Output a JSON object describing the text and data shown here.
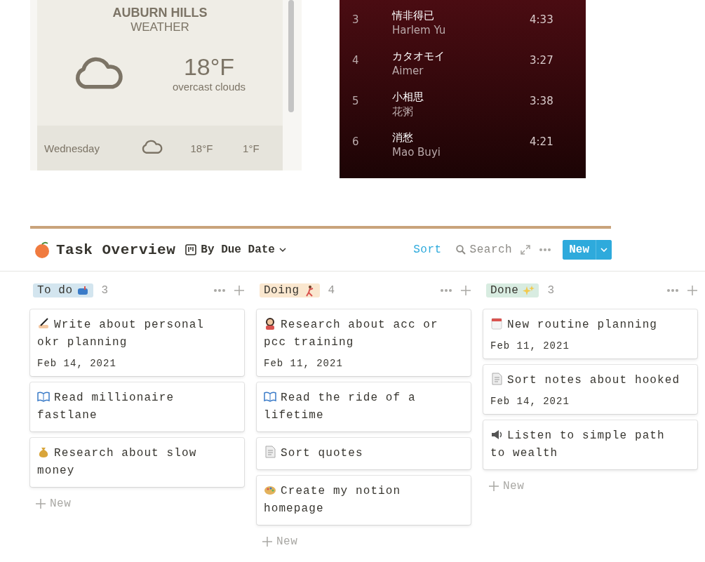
{
  "weather": {
    "city": "AUBURN HILLS",
    "subtitle": "WEATHER",
    "temperature": "18°F",
    "condition": "overcast clouds",
    "days": [
      {
        "day": "Wednesday",
        "high": "18°F",
        "low": "1°F"
      }
    ]
  },
  "playlist": {
    "tracks": [
      {
        "number": "3",
        "title": "情非得已",
        "artist": "Harlem Yu",
        "duration": "4:33"
      },
      {
        "number": "4",
        "title": "カタオモイ",
        "artist": "Aimer",
        "duration": "3:27"
      },
      {
        "number": "5",
        "title": "小相思",
        "artist": "花粥",
        "duration": "3:38"
      },
      {
        "number": "6",
        "title": "消愁",
        "artist": "Mao Buyi",
        "duration": "4:21"
      }
    ]
  },
  "board": {
    "title": "Task Overview",
    "view": "By Due Date",
    "actions": {
      "sort": "Sort",
      "search": "Search",
      "new": "New"
    },
    "columns": [
      {
        "label": "To do",
        "count": "3",
        "color": "#d3e5ef",
        "add": "New",
        "cards": [
          {
            "title": "Write about personal okr planning",
            "date": "Feb 14, 2021"
          },
          {
            "title": "Read millionaire fastlane"
          },
          {
            "title": "Research about slow money"
          }
        ]
      },
      {
        "label": "Doing",
        "count": "4",
        "color": "#fae7cf",
        "add": "New",
        "cards": [
          {
            "title": "Research about acc or pcc training",
            "date": "Feb 11, 2021"
          },
          {
            "title": "Read the ride of a lifetime"
          },
          {
            "title": "Sort quotes"
          },
          {
            "title": "Create my notion homepage"
          }
        ]
      },
      {
        "label": "Done",
        "count": "3",
        "color": "#d8ece1",
        "add": "New",
        "cards": [
          {
            "title": "New routine planning",
            "date": "Feb 11, 2021"
          },
          {
            "title": "Sort notes about hooked",
            "date": "Feb 14, 2021"
          },
          {
            "title": "Listen to simple path to wealth"
          }
        ]
      }
    ]
  }
}
